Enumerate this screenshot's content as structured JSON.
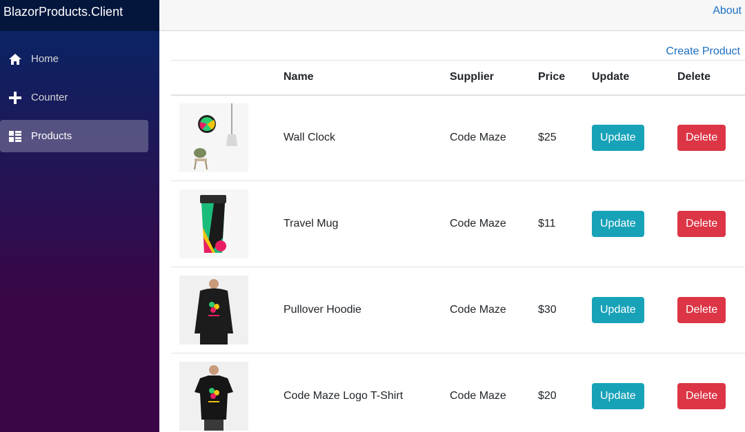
{
  "app": {
    "brand": "BlazorProducts.Client"
  },
  "sidebar": {
    "items": [
      {
        "label": "Home",
        "icon": "home-icon",
        "active": false
      },
      {
        "label": "Counter",
        "icon": "plus-icon",
        "active": false
      },
      {
        "label": "Products",
        "icon": "list-icon",
        "active": true
      }
    ]
  },
  "topbar": {
    "about": "About"
  },
  "main": {
    "create_link": "Create Product",
    "columns": [
      "",
      "Name",
      "Supplier",
      "Price",
      "Update",
      "Delete"
    ],
    "products": [
      {
        "image": "wall-clock-image",
        "name": "Wall Clock",
        "supplier": "Code Maze",
        "price": "$25",
        "update": "Update",
        "delete": "Delete"
      },
      {
        "image": "travel-mug-image",
        "name": "Travel Mug",
        "supplier": "Code Maze",
        "price": "$11",
        "update": "Update",
        "delete": "Delete"
      },
      {
        "image": "pullover-hoodie-image",
        "name": "Pullover Hoodie",
        "supplier": "Code Maze",
        "price": "$30",
        "update": "Update",
        "delete": "Delete"
      },
      {
        "image": "t-shirt-image",
        "name": "Code Maze Logo T-Shirt",
        "supplier": "Code Maze",
        "price": "$20",
        "update": "Update",
        "delete": "Delete"
      }
    ]
  },
  "colors": {
    "accent": "#1b6ec2",
    "update": "#17a2b8",
    "delete": "#dc3545"
  }
}
